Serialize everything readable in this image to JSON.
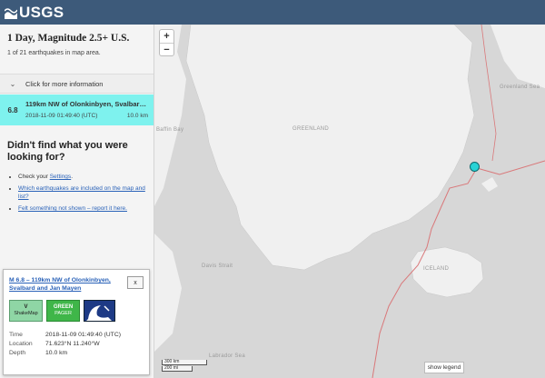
{
  "header": {
    "logo_text": "USGS"
  },
  "sidebar": {
    "title": "1 Day, Magnitude 2.5+ U.S.",
    "count": "1 of 21 earthquakes in map area.",
    "more_info": "Click for more information",
    "earthquake": {
      "magnitude": "6.8",
      "place": "119km NW of Olonkinbyen, Svalbard and Jan Mayen",
      "time": "2018-11-09 01:49:40 (UTC)",
      "depth": "10.0 km"
    },
    "help": {
      "heading": "Didn't find what you were looking for?",
      "item1_prefix": "Check your",
      "item1_link": "Settings",
      "item2_link": "Which earthquakes are included on the map and list?",
      "item3_link": "Felt something not shown – report it here."
    }
  },
  "popup": {
    "title": "M 6.8 – 119km NW of Olonkinbyen, Svalbard and Jan Mayen",
    "close_label": "x",
    "dyfi_value": "V",
    "dyfi_label": "ShakeMap",
    "pager_value": "GREEN",
    "pager_label": "PAGER",
    "time_label": "Time",
    "time_value": "2018-11-09 01:49:40 (UTC)",
    "location_label": "Location",
    "location_value": "71.623°N 11.240°W",
    "depth_label": "Depth",
    "depth_value": "10.0 km"
  },
  "map": {
    "zoom_in": "+",
    "zoom_out": "−",
    "scale_km": "300 km",
    "scale_mi": "200 mi",
    "show_legend": "show legend",
    "labels": {
      "greenland": "GREENLAND",
      "iceland": "ICELAND",
      "greenland_sea": "Greenland Sea",
      "baffin_bay": "Baffin Bay",
      "davis_strait": "Davis Strait",
      "labrador_sea": "Labrador Sea"
    },
    "land_color": "#f0f0f0",
    "water_color": "#d7d7d7",
    "plate_boundary_color": "#d9787a",
    "marker_color": "#28d3d6"
  }
}
